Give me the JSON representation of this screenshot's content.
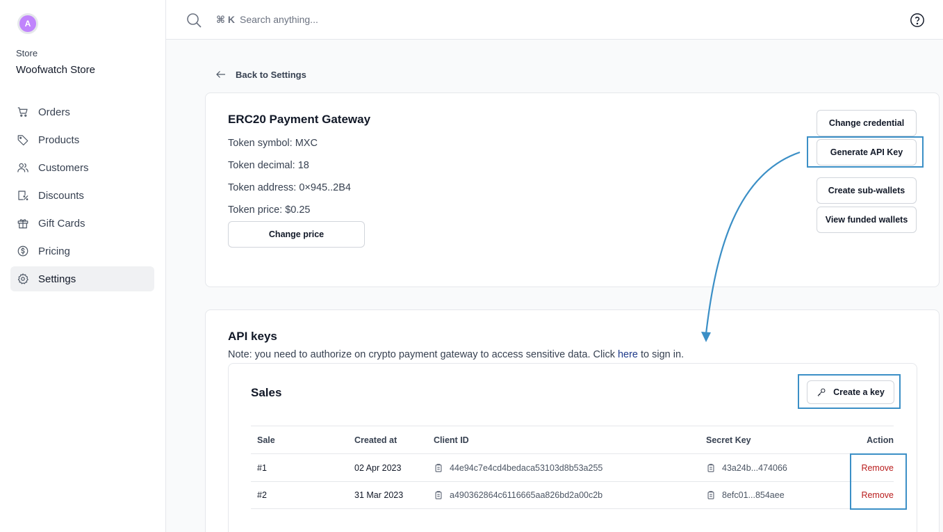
{
  "sidebar": {
    "avatar_initial": "A",
    "store_label": "Store",
    "store_name": "Woofwatch Store",
    "items": [
      {
        "label": "Orders",
        "icon": "cart-icon"
      },
      {
        "label": "Products",
        "icon": "tag-icon"
      },
      {
        "label": "Customers",
        "icon": "users-icon"
      },
      {
        "label": "Discounts",
        "icon": "discount-icon"
      },
      {
        "label": "Gift Cards",
        "icon": "gift-icon"
      },
      {
        "label": "Pricing",
        "icon": "dollar-icon"
      },
      {
        "label": "Settings",
        "icon": "gear-icon",
        "active": true
      }
    ]
  },
  "topbar": {
    "shortcut": "⌘ K",
    "search_placeholder": "Search anything..."
  },
  "back_link": "Back to Settings",
  "gateway": {
    "title": "ERC20 Payment Gateway",
    "token_symbol": "Token symbol: MXC",
    "token_decimal": "Token decimal: 18",
    "token_address": "Token address: 0×945..2B4",
    "token_price": "Token price: $0.25",
    "change_price_label": "Change price",
    "actions": {
      "change_credential": "Change credential",
      "generate_api_key": "Generate API Key",
      "create_sub_wallets": "Create sub-wallets",
      "view_funded_wallets": "View funded wallets"
    }
  },
  "api_keys": {
    "title": "API keys",
    "note_before": "Note: you need to authorize on crypto payment gateway to access sensitive data. Click ",
    "note_link": "here",
    "note_after": " to sign in.",
    "sales": {
      "title": "Sales",
      "create_key_label": "Create a key",
      "columns": {
        "sale": "Sale",
        "created_at": "Created at",
        "client_id": "Client ID",
        "secret_key": "Secret Key",
        "action": "Action"
      },
      "rows": [
        {
          "sale": "#1",
          "created_at": "02 Apr 2023",
          "client_id": "44e94c7e4cd4bedaca53103d8b53a255",
          "secret_key": "43a24b...474066",
          "action": "Remove"
        },
        {
          "sale": "#2",
          "created_at": "31 Mar 2023",
          "client_id": "a490362864c6116665aa826bd2a00c2b",
          "secret_key": "8efc01...854aee",
          "action": "Remove"
        }
      ]
    }
  },
  "colors": {
    "highlight": "#3b8fc6",
    "remove": "#b91c1c",
    "avatar": "#c084fc",
    "active_nav": "#f0f1f3"
  }
}
